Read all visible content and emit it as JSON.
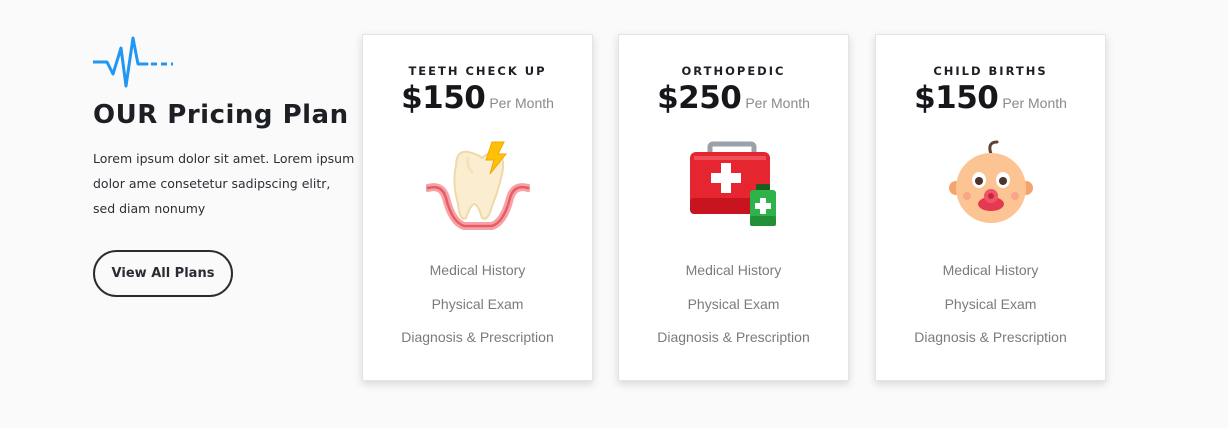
{
  "intro": {
    "icon": "heartbeat-pulse-icon",
    "accent_color": "#2196f3",
    "title": "OUR Pricing Plan",
    "text": "Lorem ipsum dolor sit amet. Lorem ipsum dolor ame consetetur sadipscing elitr, sed diam nonumy",
    "button_label": "View All Plans"
  },
  "plans": [
    {
      "title": "TEETH CHECK UP",
      "price": "$150",
      "period": "Per Month",
      "icon": "tooth-pain-icon",
      "features": [
        "Medical History",
        "Physical Exam",
        "Diagnosis & Prescription"
      ]
    },
    {
      "title": "ORTHOPEDIC",
      "price": "$250",
      "period": "Per Month",
      "icon": "first-aid-kit-icon",
      "features": [
        "Medical History",
        "Physical Exam",
        "Diagnosis & Prescription"
      ]
    },
    {
      "title": "CHILD BIRTHS",
      "price": "$150",
      "period": "Per Month",
      "icon": "baby-face-icon",
      "features": [
        "Medical History",
        "Physical Exam",
        "Diagnosis & Prescription"
      ]
    }
  ]
}
